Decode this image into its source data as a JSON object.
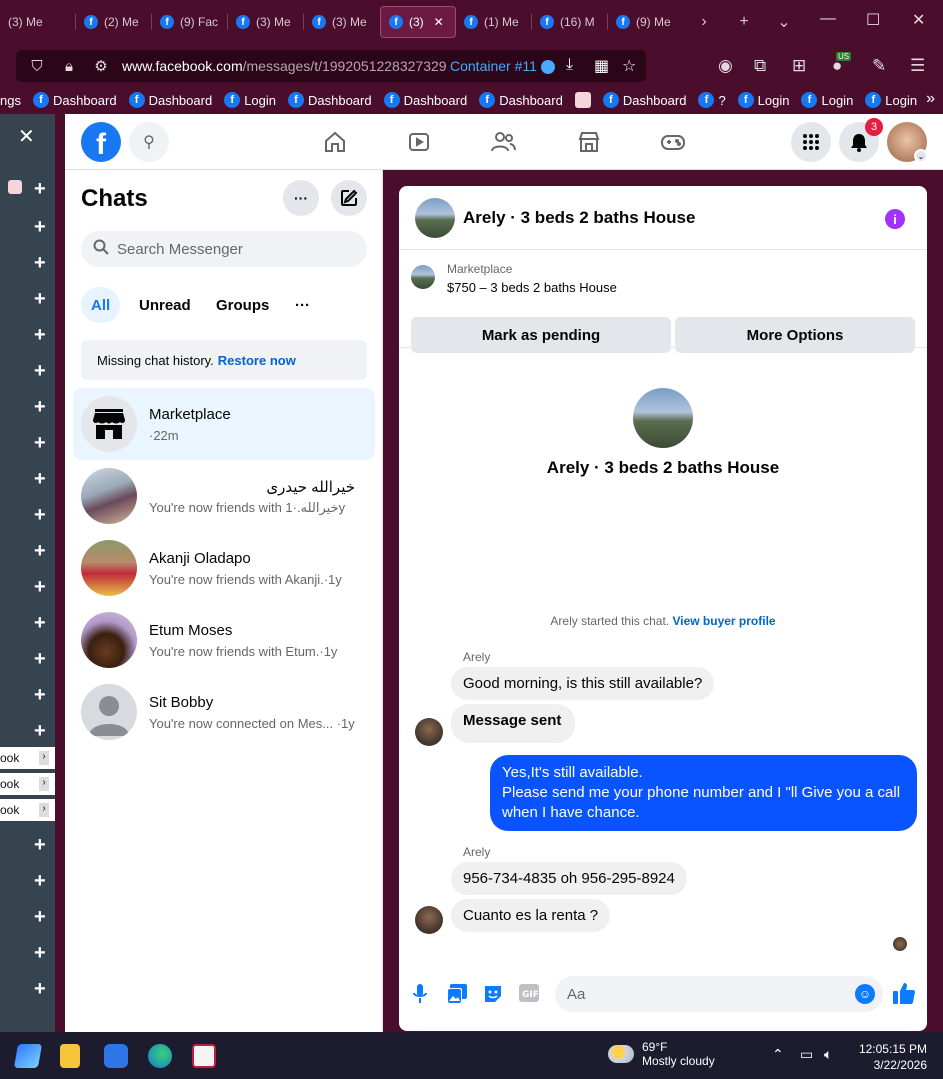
{
  "browser": {
    "tabs": [
      {
        "label": "(3) Me",
        "favicon": false
      },
      {
        "label": "(2) Me",
        "favicon": true
      },
      {
        "label": "(9) Fac",
        "favicon": true
      },
      {
        "label": "(3) Me",
        "favicon": true
      },
      {
        "label": "(3) Me",
        "favicon": true
      },
      {
        "label": "(3)",
        "favicon": true,
        "active": true
      },
      {
        "label": "(1) Me",
        "favicon": true
      },
      {
        "label": "(16) M",
        "favicon": true
      },
      {
        "label": "(9) Me",
        "favicon": true
      }
    ],
    "url_domain": "www.facebook.com",
    "url_path": "/messages/t/1992051228327329",
    "container_label": "Container #11",
    "extension_badge": "US",
    "bookmarks": [
      {
        "label": "ngs",
        "icon": "none"
      },
      {
        "label": "Dashboard",
        "icon": "facebook-icon"
      },
      {
        "label": "Dashboard",
        "icon": "facebook-icon"
      },
      {
        "label": "Login",
        "icon": "facebook-icon"
      },
      {
        "label": "Dashboard",
        "icon": "facebook-icon"
      },
      {
        "label": "Dashboard",
        "icon": "facebook-icon"
      },
      {
        "label": "Dashboard",
        "icon": "facebook-icon"
      },
      {
        "label": "",
        "icon": "pink-square-icon"
      },
      {
        "label": "Dashboard",
        "icon": "facebook-icon"
      },
      {
        "label": "?",
        "icon": "facebook-icon"
      },
      {
        "label": "Login",
        "icon": "facebook-icon"
      },
      {
        "label": "Login",
        "icon": "facebook-icon"
      },
      {
        "label": "Login",
        "icon": "facebook-icon"
      }
    ]
  },
  "sidebar": {
    "pills": [
      "ook",
      "ook",
      "ook"
    ]
  },
  "fb_header": {
    "notification_count": "3"
  },
  "chatlist": {
    "title": "Chats",
    "search_placeholder": "Search Messenger",
    "filters": [
      "All",
      "Unread",
      "Groups"
    ],
    "active_filter": "All",
    "missing_history_text": "Missing chat history.",
    "restore_link": "Restore now",
    "chats": [
      {
        "name": "Marketplace",
        "sub": "·22m",
        "selected": true,
        "avatar": "store-icon"
      },
      {
        "name": "خیرالله حیدری",
        "sub": "You're now friends with خیرالله.·1y",
        "rtl": true
      },
      {
        "name": "Akanji Oladapo",
        "sub": "You're now friends with Akanji.·1y"
      },
      {
        "name": "Etum Moses",
        "sub": "You're now friends with Etum.·1y"
      },
      {
        "name": "Sit Bobby",
        "sub": "You're now connected on Mes... ·1y"
      }
    ]
  },
  "conversation": {
    "header_title": "Arely · 3 beds 2 baths House",
    "marketplace_label": "Marketplace",
    "listing": "$750 – 3 beds 2 baths House",
    "mark_pending_label": "Mark as pending",
    "more_options_label": "More Options",
    "intro_title": "Arely · 3 beds 2 baths House",
    "started_text": "Arely started this chat.",
    "view_profile_link": "View buyer profile",
    "messages": [
      {
        "sender": "Arely",
        "text": "Good morning, is this still available?",
        "direction": "in"
      },
      {
        "text": "Message sent",
        "direction": "in",
        "bold": true
      },
      {
        "text": "Yes,It's still available.\nPlease send me your phone number and I \"ll Give you a call when I have chance.",
        "direction": "out"
      },
      {
        "sender": "Arely",
        "text": "956-734-4835 oh 956-295-8924",
        "direction": "in"
      },
      {
        "text": "Cuanto es la renta ?",
        "direction": "in"
      }
    ],
    "composer_placeholder": "Aa"
  },
  "taskbar": {
    "temperature": "69°F",
    "weather": "Mostly cloudy",
    "time": "12:05:15 PM",
    "date": "3/22/2026"
  },
  "colors": {
    "browser_bg": "#4a0e2c",
    "fb_blue": "#1877f2",
    "outgoing_bubble": "#0a54ff",
    "info_purple": "#a033ff"
  }
}
